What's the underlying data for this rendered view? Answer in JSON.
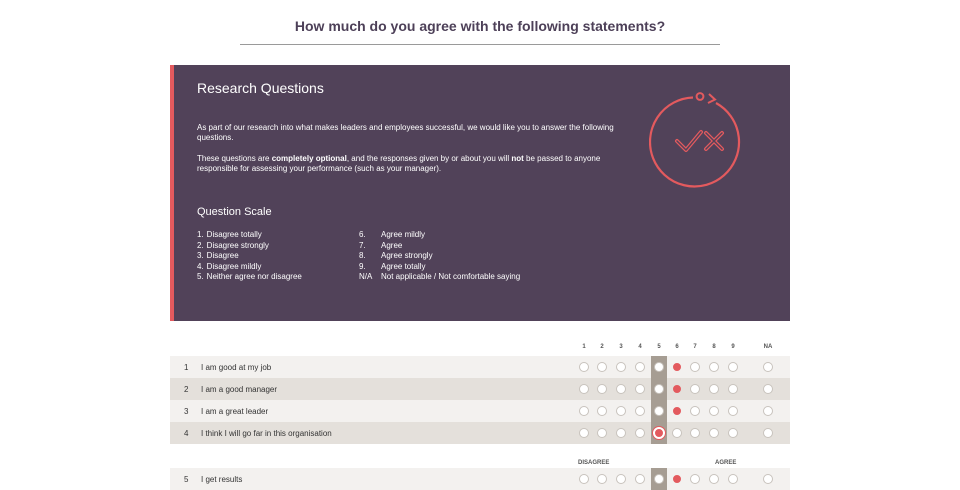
{
  "header": {
    "title": "How much do you agree with the following statements?"
  },
  "intro": {
    "heading": "Research Questions",
    "p1": "As part of our research into what makes leaders and employees successful, we would like you to answer the following questions.",
    "p2_a": "These questions are ",
    "p2_b": "completely optional",
    "p2_c": ", and the responses given by or about you will ",
    "p2_d": "not",
    "p2_e": " be passed to anyone responsible for assessing your performance (such as your manager).",
    "icon": "check-cross-icon",
    "scale_heading": "Question Scale",
    "scale_left": [
      {
        "num": "1.",
        "text": "Disagree totally"
      },
      {
        "num": "2.",
        "text": "Disagree strongly"
      },
      {
        "num": "3.",
        "text": "Disagree"
      },
      {
        "num": "4.",
        "text": "Disagree mildly"
      },
      {
        "num": "5.",
        "text": "Neither agree nor disagree"
      }
    ],
    "scale_right": [
      {
        "num": "6.",
        "text": "Agree mildly"
      },
      {
        "num": "7.",
        "text": "Agree"
      },
      {
        "num": "8.",
        "text": "Agree strongly"
      },
      {
        "num": "9.",
        "text": "Agree totally"
      },
      {
        "num": "N/A",
        "text": "Not applicable / Not comfortable saying"
      }
    ]
  },
  "grid": {
    "columns": [
      "1",
      "2",
      "3",
      "4",
      "5",
      "6",
      "7",
      "8",
      "9",
      "NA"
    ],
    "caption_left": "DISAGREE",
    "caption_right": "AGREE",
    "questions": [
      {
        "num": "1",
        "text": "I am good at my job",
        "selected": "6"
      },
      {
        "num": "2",
        "text": "I am a good manager",
        "selected": "6"
      },
      {
        "num": "3",
        "text": "I am a great leader",
        "selected": "6"
      },
      {
        "num": "4",
        "text": "I think I will go far in this organisation",
        "selected": "5"
      },
      {
        "num": "5",
        "text": "I get results",
        "selected": "6"
      }
    ]
  },
  "colors": {
    "panel": "#514259",
    "accent": "#e35a5e",
    "row_light": "#f3f1ef",
    "row_dark": "#e4e0db"
  }
}
